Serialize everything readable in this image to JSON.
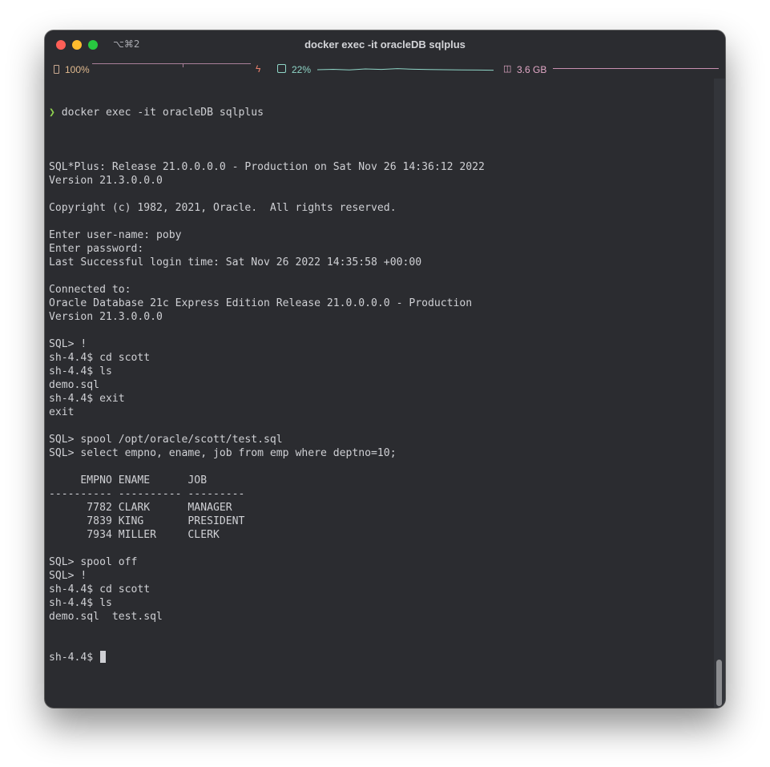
{
  "window": {
    "shortcut": "⌥⌘2",
    "title": "docker exec -it oracleDB sqlplus"
  },
  "statusbar": {
    "battery": "100%",
    "cpu": "22%",
    "memory": "3.6 GB",
    "icons": [
      "battery-icon",
      "charging-bolt-icon",
      "cpu-icon",
      "memory-icon"
    ],
    "colors": {
      "battery": "#e0b98e",
      "cpu": "#8fd6c7",
      "memory": "#e2a8c6",
      "charging": "#e8806c"
    }
  },
  "terminal": {
    "command": "docker exec -it oracleDB sqlplus",
    "prompt_symbol": "❯",
    "lines": [
      "",
      "SQL*Plus: Release 21.0.0.0.0 - Production on Sat Nov 26 14:36:12 2022",
      "Version 21.3.0.0.0",
      "",
      "Copyright (c) 1982, 2021, Oracle.  All rights reserved.",
      "",
      "Enter user-name: poby",
      "Enter password:",
      "Last Successful login time: Sat Nov 26 2022 14:35:58 +00:00",
      "",
      "Connected to:",
      "Oracle Database 21c Express Edition Release 21.0.0.0.0 - Production",
      "Version 21.3.0.0.0",
      "",
      "SQL> !",
      "sh-4.4$ cd scott",
      "sh-4.4$ ls",
      "demo.sql",
      "sh-4.4$ exit",
      "exit",
      "",
      "SQL> spool /opt/oracle/scott/test.sql",
      "SQL> select empno, ename, job from emp where deptno=10;",
      "",
      "     EMPNO ENAME      JOB",
      "---------- ---------- ---------",
      "      7782 CLARK      MANAGER",
      "      7839 KING       PRESIDENT",
      "      7934 MILLER     CLERK",
      "",
      "SQL> spool off",
      "SQL> !",
      "sh-4.4$ cd scott",
      "sh-4.4$ ls",
      "demo.sql  test.sql"
    ],
    "current_prompt": "sh-4.4$ "
  },
  "colors": {
    "background": "#2b2c30",
    "text": "#cfd0d4",
    "prompt_arrow": "#8fd14f"
  }
}
